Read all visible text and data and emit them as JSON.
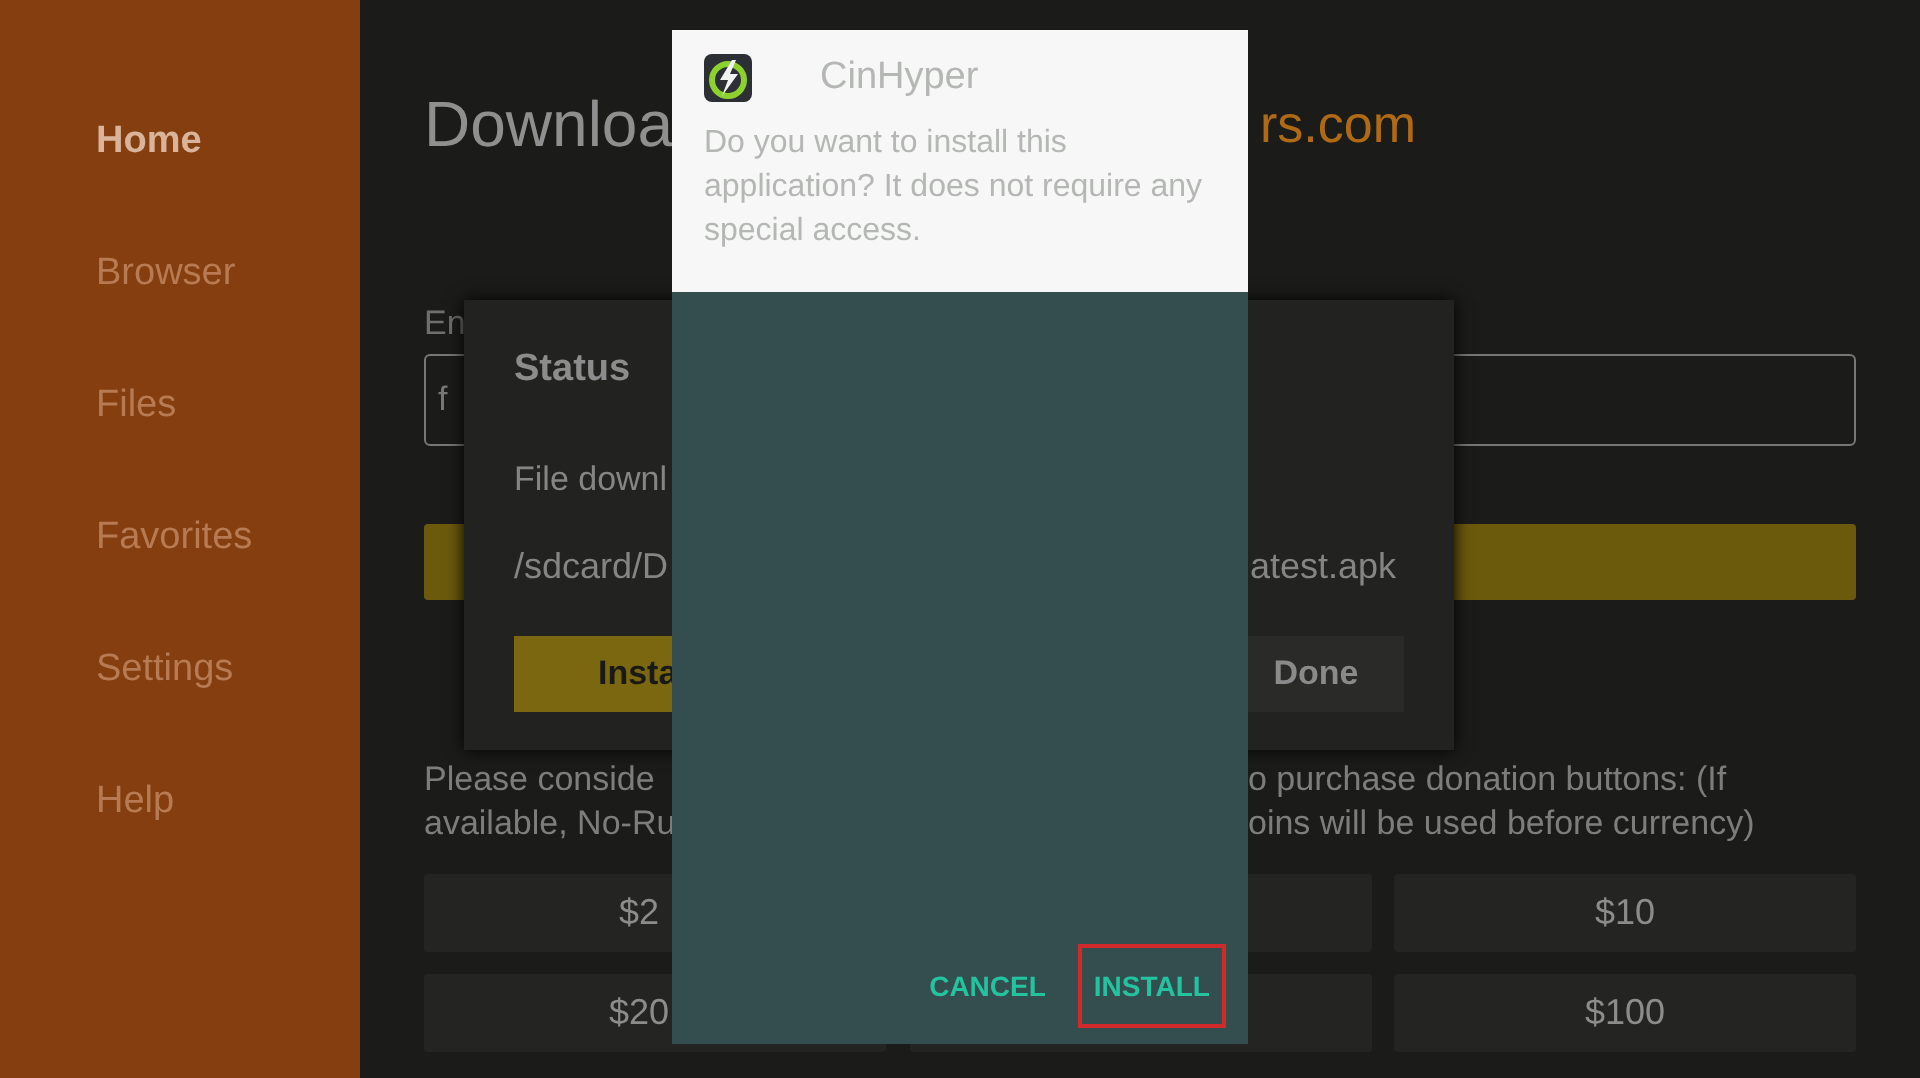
{
  "sidebar": {
    "items": [
      {
        "label": "Home",
        "selected": true
      },
      {
        "label": "Browser",
        "selected": false
      },
      {
        "label": "Files",
        "selected": false
      },
      {
        "label": "Favorites",
        "selected": false
      },
      {
        "label": "Settings",
        "selected": false
      },
      {
        "label": "Help",
        "selected": false
      }
    ]
  },
  "page": {
    "title_start": "Downloa",
    "title_end": "rs.com",
    "url_label": "En",
    "url_field": {
      "value": "f"
    },
    "donation_note": {
      "line_1_start": "Please conside",
      "line_1_end": "o purchase donation buttons: (If",
      "line_2_start": "available, No-Ru",
      "line_2_end": "oins will be used before currency)"
    },
    "donation_rows": [
      {
        "left": "$2",
        "right": "$10"
      },
      {
        "left": "$20",
        "right": "$100"
      }
    ]
  },
  "status_dialog": {
    "title": "Status",
    "message": "File downl",
    "path_start": "/sdcard/D",
    "path_end": "atest.apk",
    "buttons": [
      {
        "label": "Insta",
        "kind": "primary"
      },
      {
        "label": "Done",
        "kind": "plain"
      }
    ]
  },
  "install_dialog": {
    "app_name": "CinHyper",
    "message": "Do you want to install this application? It does not require any special access.",
    "buttons": [
      {
        "label": "CANCEL",
        "focused": false
      },
      {
        "label": "INSTALL",
        "focused": true
      }
    ]
  }
}
